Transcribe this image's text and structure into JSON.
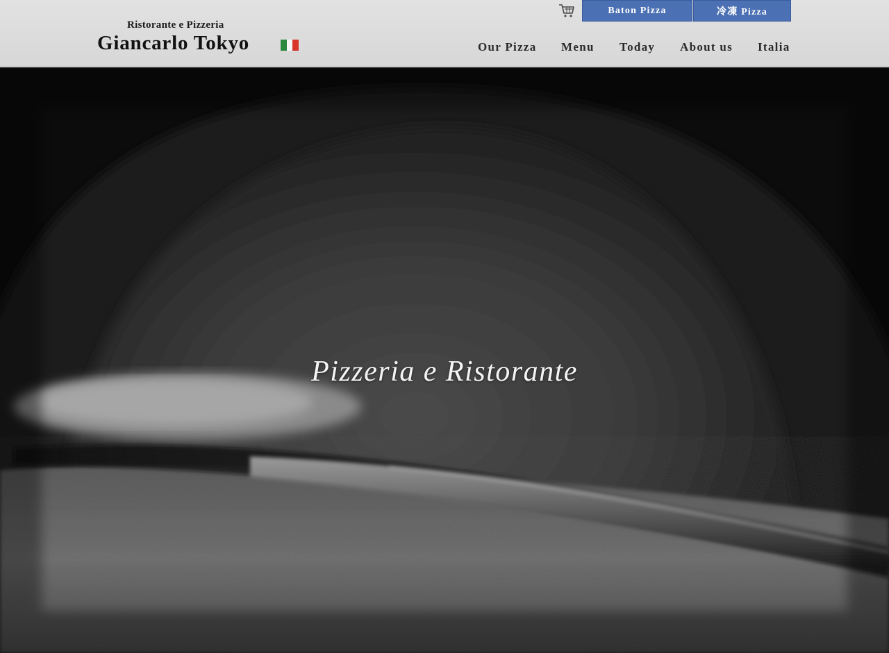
{
  "header": {
    "logo_sub": "Ristorante e Pizzeria",
    "logo_main": "Giancarlo Tokyo",
    "flag_colors": [
      "#2b8a3e",
      "#f4f4f4",
      "#d8342c"
    ],
    "cart_icon": "shopping-cart-icon",
    "buttons": {
      "baton": "Baton Pizza",
      "frozen": "冷凍 Pizza",
      "color": "#4b70b4"
    },
    "nav": {
      "our_pizza": "Our Pizza",
      "menu": "Menu",
      "today": "Today",
      "about_us": "About us",
      "italia": "Italia"
    }
  },
  "hero": {
    "title": "Pizzeria e Ristorante"
  }
}
